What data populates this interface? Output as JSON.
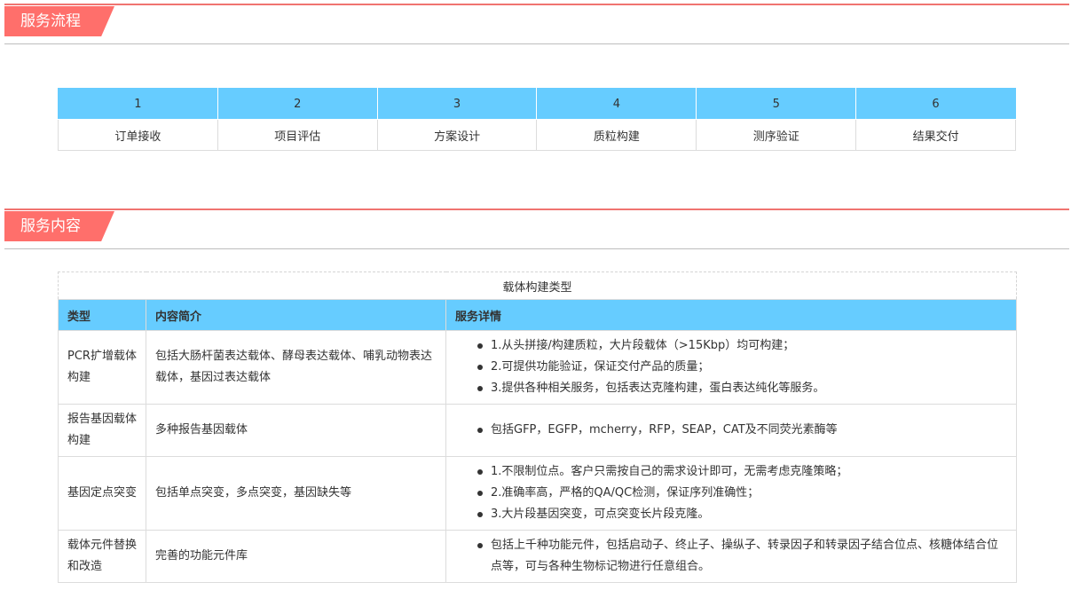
{
  "section1": {
    "title": "服务流程"
  },
  "process": {
    "steps": [
      {
        "num": "1",
        "name": "订单接收"
      },
      {
        "num": "2",
        "name": "项目评估"
      },
      {
        "num": "3",
        "name": "方案设计"
      },
      {
        "num": "4",
        "name": "质粒构建"
      },
      {
        "num": "5",
        "name": "测序验证"
      },
      {
        "num": "6",
        "name": "结果交付"
      }
    ]
  },
  "section2": {
    "title": "服务内容"
  },
  "content_table": {
    "caption": "载体构建类型",
    "headers": {
      "type": "类型",
      "intro": "内容简介",
      "detail": "服务详情"
    },
    "rows": [
      {
        "type": "PCR扩增载体构建",
        "intro": "包括大肠杆菌表达载体、酵母表达载体、哺乳动物表达载体，基因过表达载体",
        "details": [
          "1.从头拼接/构建质粒，大片段载体（>15Kbp）均可构建；",
          "2.可提供功能验证，保证交付产品的质量；",
          "3.提供各种相关服务，包括表达克隆构建，蛋白表达纯化等服务。"
        ]
      },
      {
        "type": "报告基因载体构建",
        "intro": "多种报告基因载体",
        "details": [
          "包括GFP，EGFP，mcherry，RFP，SEAP，CAT及不同荧光素酶等"
        ]
      },
      {
        "type": "基因定点突变",
        "intro": "包括单点突变，多点突变，基因缺失等",
        "details": [
          "1.不限制位点。客户只需按自己的需求设计即可，无需考虑克隆策略；",
          "2.准确率高，严格的QA/QC检测，保证序列准确性；",
          "3.大片段基因突变，可点突变长片段克隆。"
        ]
      },
      {
        "type": "载体元件替换和改造",
        "intro": "完善的功能元件库",
        "details": [
          "包括上千种功能元件，包括启动子、终止子、操纵子、转录因子和转录因子结合位点、核糖体结合位点等，可与各种生物标记物进行任意组合。"
        ]
      }
    ]
  }
}
